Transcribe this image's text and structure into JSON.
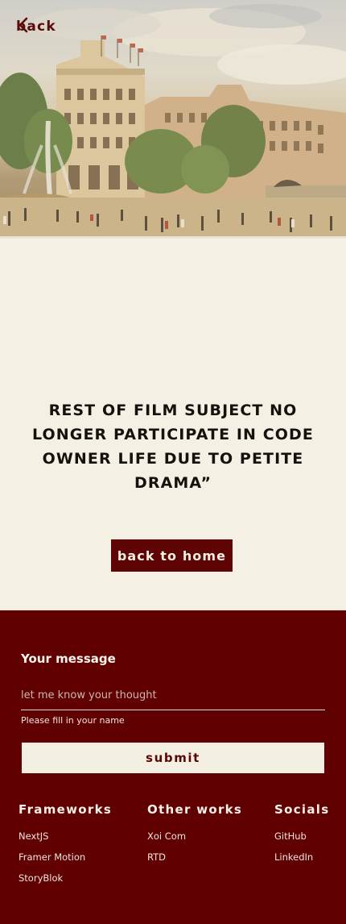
{
  "header": {
    "back_label": "back"
  },
  "main": {
    "quote": "REST OF FILM SUBJECT NO LONGER PARTICIPATE IN CODE OWNER LIFE DUE TO PETITE DRAMA”",
    "home_button": "back to home"
  },
  "footer": {
    "message_label": "Your message",
    "message_placeholder": "let me know your thought",
    "hint": "Please fill in your name",
    "submit_label": "submit",
    "columns": [
      {
        "title": "Frameworks",
        "links": [
          "NextJS",
          "Framer Motion",
          "StoryBlok"
        ]
      },
      {
        "title": "Other works",
        "links": [
          "Xoi Com",
          "RTD"
        ]
      },
      {
        "title": "Socials",
        "links": [
          "GitHub",
          "LinkedIn"
        ]
      }
    ]
  },
  "colors": {
    "accent": "#600000",
    "background": "#f4f0e3",
    "button_light": "#f4efe3"
  },
  "icons": {
    "back": "chevron-left-icon"
  }
}
